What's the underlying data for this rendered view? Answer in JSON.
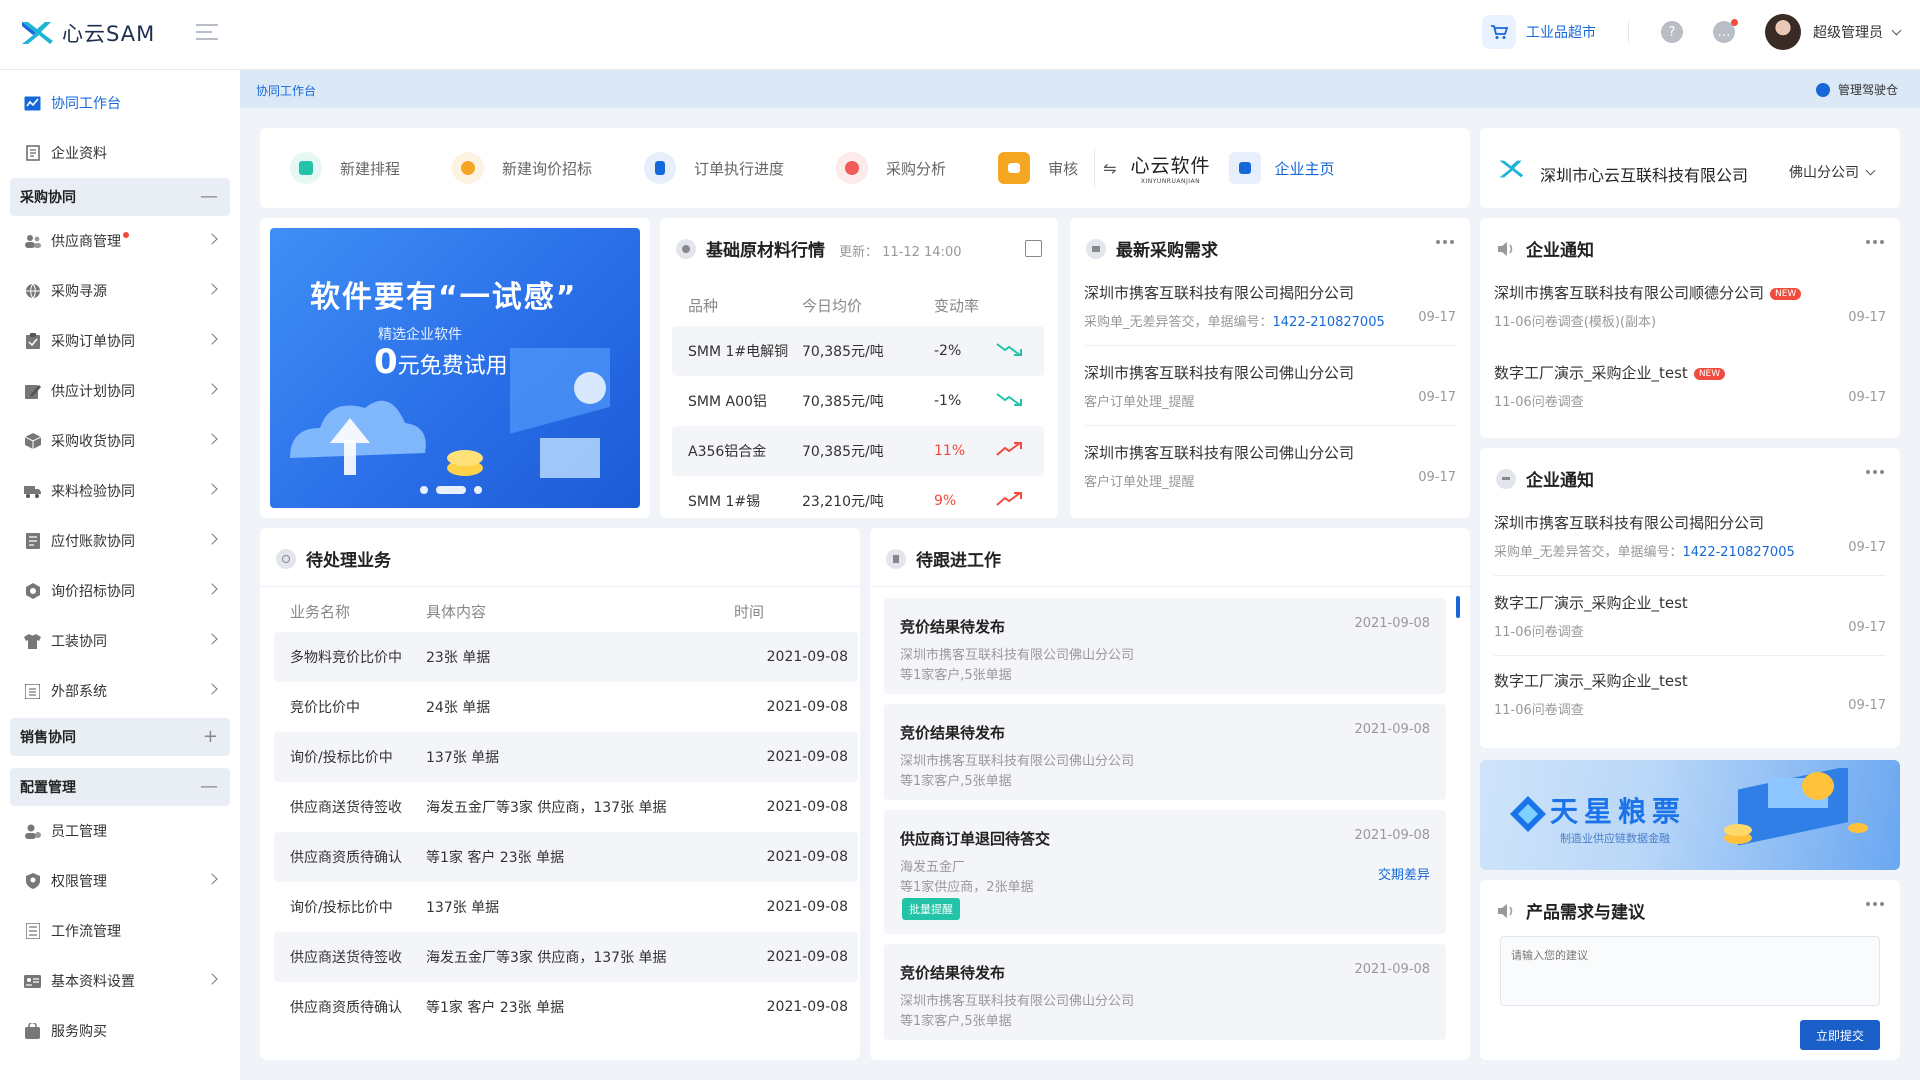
{
  "app": {
    "logo_text": "心云SAM"
  },
  "topbar": {
    "shop_label": "工业品超市",
    "help_glyph": "?",
    "message_glyph": "…",
    "username": "超级管理员"
  },
  "breadcrumb": {
    "current": "协同工作台",
    "cockpit_label": "管理驾驶仓"
  },
  "sidebar": {
    "top_items": [
      {
        "label": "协同工作台"
      },
      {
        "label": "企业资料"
      }
    ],
    "groups": [
      {
        "label": "采购协同",
        "marker": "—",
        "items": [
          {
            "label": "供应商管理"
          },
          {
            "label": "采购寻源"
          },
          {
            "label": "采购订单协同"
          },
          {
            "label": "供应计划协同"
          },
          {
            "label": "采购收货协同"
          },
          {
            "label": "来料检验协同"
          },
          {
            "label": "应付账款协同"
          },
          {
            "label": "询价招标协同"
          },
          {
            "label": "工装协同"
          },
          {
            "label": "外部系统"
          }
        ]
      },
      {
        "label": "销售协同",
        "marker": "+"
      },
      {
        "label": "配置管理",
        "marker": "—",
        "items": [
          {
            "label": "员工管理"
          },
          {
            "label": "权限管理"
          },
          {
            "label": "工作流管理"
          },
          {
            "label": "基本资料设置"
          },
          {
            "label": "服务购买"
          }
        ]
      }
    ]
  },
  "quick_actions": [
    {
      "label": "新建排程",
      "color": "#22c3a6",
      "bg": "#e6f8f4"
    },
    {
      "label": "新建询价招标",
      "color": "#f5a623",
      "bg": "#fdf3e2"
    },
    {
      "label": "订单执行进度",
      "color": "#1668d9",
      "bg": "#e6effb"
    },
    {
      "label": "采购分析",
      "color": "#f25a5a",
      "bg": "#fdeaea"
    },
    {
      "label": "审核",
      "color": "#fff",
      "bg": "#f5a623"
    }
  ],
  "brand": {
    "swap_glyph": "⇋",
    "name": "心云软件",
    "pinyin": "XINYUNRUANJIAN",
    "home_label": "企业主页"
  },
  "company": {
    "name": "深圳市心云互联科技有限公司",
    "branch": "佛山分公司"
  },
  "banner": {
    "title": "软件要有“一试感”",
    "subtitle": "精选企业软件",
    "offer_big": "0",
    "offer_rest": "元免费试用"
  },
  "materials": {
    "title": "基础原材料行情",
    "updated": "更新： 11-12 14:00",
    "columns": [
      "品种",
      "今日均价",
      "变动率"
    ],
    "rows": [
      {
        "name": "SMM 1#电解铜",
        "price": "70,385元/吨",
        "change": "-2%",
        "dir": "down"
      },
      {
        "name": "SMM A00铝",
        "price": "70,385元/吨",
        "change": "-1%",
        "dir": "down"
      },
      {
        "name": "A356铝合金",
        "price": "70,385元/吨",
        "change": "11%",
        "dir": "up"
      },
      {
        "name": "SMM 1#锡",
        "price": "23,210元/吨",
        "change": "9%",
        "dir": "up"
      }
    ]
  },
  "needs": {
    "title": "最新采购需求",
    "items": [
      {
        "title": "深圳市携客互联科技有限公司揭阳分公司",
        "sub": "采购单_无差异答交，单据编号：",
        "link": "1422-210827005",
        "date": "09-17"
      },
      {
        "title": "深圳市携客互联科技有限公司佛山分公司",
        "sub": "客户订单处理_提醒",
        "link": "",
        "date": "09-17"
      },
      {
        "title": "深圳市携客互联科技有限公司佛山分公司",
        "sub": "客户订单处理_提醒",
        "link": "",
        "date": "09-17"
      }
    ]
  },
  "notice1": {
    "title": "企业通知",
    "items": [
      {
        "title": "深圳市携客互联科技有限公司顺德分公司",
        "badge": "NEW",
        "sub": "11-06问卷调查(模板)(副本)",
        "date": "09-17"
      },
      {
        "title": "数字工厂演示_采购企业_test",
        "badge": "NEW",
        "sub": "11-06问卷调查",
        "date": "09-17"
      }
    ]
  },
  "notice2": {
    "title": "企业通知",
    "items": [
      {
        "title": "深圳市携客互联科技有限公司揭阳分公司",
        "sub": "采购单_无差异答交，单据编号：",
        "link": "1422-210827005",
        "date": "09-17"
      },
      {
        "title": "数字工厂演示_采购企业_test",
        "sub": "11-06问卷调查",
        "link": "",
        "date": "09-17"
      },
      {
        "title": "数字工厂演示_采购企业_test",
        "sub": "11-06问卷调查",
        "link": "",
        "date": "09-17"
      }
    ]
  },
  "pending": {
    "title": "待处理业务",
    "columns": [
      "业务名称",
      "具体内容",
      "时间"
    ],
    "rows": [
      {
        "name": "多物料竞价比价中",
        "content": "23张 单据",
        "time": "2021-09-08"
      },
      {
        "name": "竞价比价中",
        "content": "24张 单据",
        "time": "2021-09-08"
      },
      {
        "name": "询价/投标比价中",
        "content": "137张 单据",
        "time": "2021-09-08"
      },
      {
        "name": "供应商送货待签收",
        "content": "海发五金厂等3家 供应商，137张 单据",
        "time": "2021-09-08"
      },
      {
        "name": "供应商资质待确认",
        "content": "等1家 客户 23张 单据",
        "time": "2021-09-08"
      },
      {
        "name": "询价/投标比价中",
        "content": "137张 单据",
        "time": "2021-09-08"
      },
      {
        "name": "供应商送货待签收",
        "content": "海发五金厂等3家 供应商，137张 单据",
        "time": "2021-09-08"
      },
      {
        "name": "供应商资质待确认",
        "content": "等1家 客户 23张 单据",
        "time": "2021-09-08"
      }
    ]
  },
  "followup": {
    "title": "待跟进工作",
    "items": [
      {
        "title": "竞价结果待发布",
        "date": "2021-09-08",
        "line1": "深圳市携客互联科技有限公司佛山分公司",
        "line2": "等1家客户,5张单据"
      },
      {
        "title": "竞价结果待发布",
        "date": "2021-09-08",
        "line1": "深圳市携客互联科技有限公司佛山分公司",
        "line2": "等1家客户,5张单据"
      },
      {
        "title": "供应商订单退回待答交",
        "date": "2021-09-08",
        "line1": "海发五金厂",
        "line2": "等1家供应商，2张单据",
        "link": "交期差异",
        "tag": "批量提醒"
      },
      {
        "title": "竞价结果待发布",
        "date": "2021-09-08",
        "line1": "深圳市携客互联科技有限公司佛山分公司",
        "line2": "等1家客户,5张单据"
      }
    ]
  },
  "tianxing": {
    "title": "天星粮票",
    "subtitle": "制造业供应链数据金融"
  },
  "suggest": {
    "title": "产品需求与建议",
    "placeholder": "请输入您的建议",
    "submit": "立即提交"
  }
}
